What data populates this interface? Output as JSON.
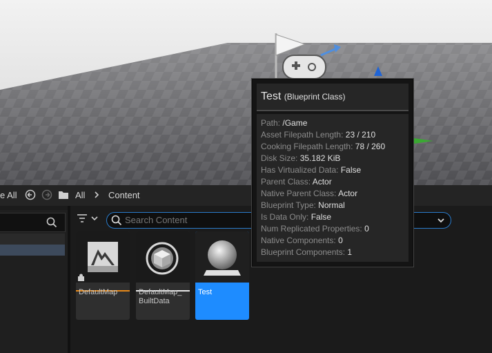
{
  "breadcrumb": {
    "partial_label": "e All",
    "root": "All",
    "current": "Content"
  },
  "search": {
    "placeholder": "Search Content"
  },
  "assets": [
    {
      "name": "DefaultMap",
      "type": "map"
    },
    {
      "name": "DefaultMap_ BuiltData",
      "type": "builtdata"
    },
    {
      "name": "Test",
      "type": "blueprint",
      "selected": true
    }
  ],
  "tooltip": {
    "title": "Test",
    "subtitle": "(Blueprint Class)",
    "rows": [
      {
        "key": "Path:",
        "value": "/Game"
      },
      {
        "key": "Asset Filepath Length:",
        "value": "23 / 210"
      },
      {
        "key": "Cooking Filepath Length:",
        "value": "78 / 260"
      },
      {
        "key": "Disk Size:",
        "value": "35.182 KiB"
      },
      {
        "key": "Has Virtualized Data:",
        "value": "False"
      },
      {
        "key": "Parent Class:",
        "value": "Actor"
      },
      {
        "key": "Native Parent Class:",
        "value": "Actor"
      },
      {
        "key": "Blueprint Type:",
        "value": "Normal"
      },
      {
        "key": "Is Data Only:",
        "value": "False"
      },
      {
        "key": "Num Replicated Properties:",
        "value": "0"
      },
      {
        "key": "Native Components:",
        "value": "0"
      },
      {
        "key": "Blueprint Components:",
        "value": "1"
      }
    ]
  },
  "colors": {
    "selection": "#1e8cff",
    "search_border": "#2a7ccc",
    "map_underline": "#e88a1a",
    "builtdata_underline": "#e8e8e8"
  },
  "icons": [
    "flag-icon",
    "gamepad-icon",
    "gizmo-arrow-icon",
    "back-arrow-icon",
    "forward-arrow-icon",
    "folder-icon",
    "chevron-right-icon",
    "search-icon",
    "filter-icon",
    "chevron-down-icon",
    "map-icon",
    "sphere-icon",
    "puzzle-icon"
  ]
}
